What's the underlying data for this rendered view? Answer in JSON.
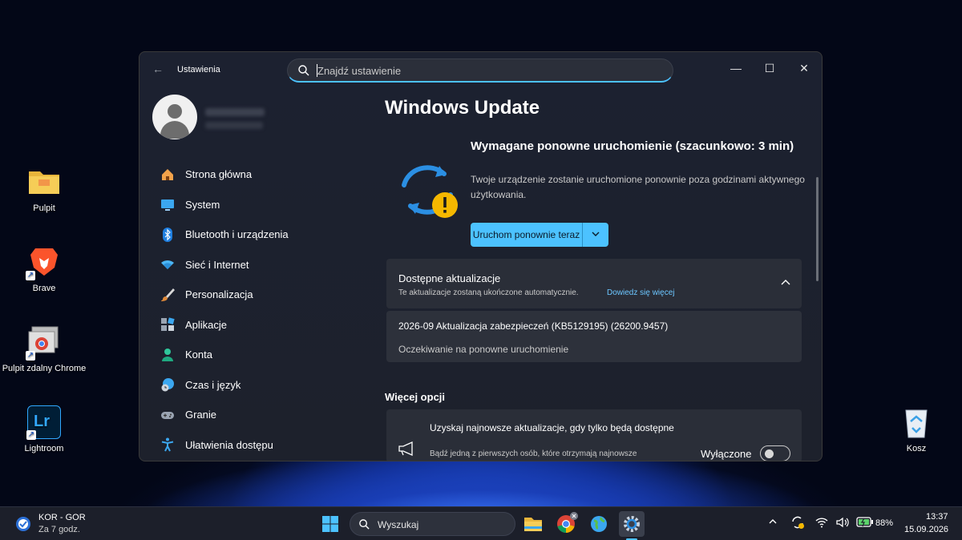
{
  "desktop": {
    "icons": [
      {
        "label": "Pulpit",
        "icon": "folder-icon"
      },
      {
        "label": "Brave",
        "icon": "brave-icon"
      },
      {
        "label": "Pulpit zdalny Chrome",
        "icon": "chrome-remote-desktop-icon"
      },
      {
        "label": "Lightroom",
        "icon": "lightroom-icon"
      },
      {
        "label": "Kosz",
        "icon": "recycle-bin-icon"
      }
    ]
  },
  "window": {
    "app_title": "Ustawienia",
    "search_placeholder": "Znajdź ustawienie",
    "controls": {
      "minimize": "—",
      "maximize": "☐",
      "close": "✕"
    }
  },
  "sidebar": {
    "items": [
      {
        "label": "Strona główna",
        "icon": "home-icon"
      },
      {
        "label": "System",
        "icon": "system-icon"
      },
      {
        "label": "Bluetooth i urządzenia",
        "icon": "bluetooth-icon"
      },
      {
        "label": "Sieć i Internet",
        "icon": "wifi-icon"
      },
      {
        "label": "Personalizacja",
        "icon": "brush-icon"
      },
      {
        "label": "Aplikacje",
        "icon": "apps-icon"
      },
      {
        "label": "Konta",
        "icon": "account-icon"
      },
      {
        "label": "Czas i język",
        "icon": "globe-clock-icon"
      },
      {
        "label": "Granie",
        "icon": "gamepad-icon"
      },
      {
        "label": "Ułatwienia dostępu",
        "icon": "accessibility-icon"
      }
    ]
  },
  "main": {
    "title": "Windows Update",
    "status_title": "Wymagane ponowne uruchomienie (szacunkowo: 3 min)",
    "status_desc": "Twoje urządzenie zostanie uruchomione ponownie poza godzinami aktywnego użytkowania.",
    "restart_button": "Uruchom ponownie teraz",
    "available": {
      "title": "Dostępne aktualizacje",
      "subtitle": "Te aktualizacje zostaną ukończone automatycznie.",
      "link": "Dowiedz się więcej"
    },
    "update_item": {
      "name": "2026-09 Aktualizacja zabezpieczeń (KB5129195) (26200.9457)",
      "status": "Oczekiwanie na ponowne uruchomienie"
    },
    "more_options_title": "Więcej opcji",
    "option": {
      "title": "Uzyskaj najnowsze aktualizacje, gdy tylko będą dostępne",
      "desc": "Bądź jedną z pierwszych osób, które otrzymają najnowsze",
      "state": "Wyłączone",
      "enabled": false
    }
  },
  "taskbar": {
    "weather_line1": "KOR - GOR",
    "weather_line2": "Za 7 godz.",
    "search_label": "Wyszukaj",
    "battery": "88%",
    "time": "13:37",
    "date": "15.09.2026"
  },
  "colors": {
    "accent": "#4cc2ff",
    "warning": "#f5b800",
    "window_bg": "#1d212c"
  }
}
